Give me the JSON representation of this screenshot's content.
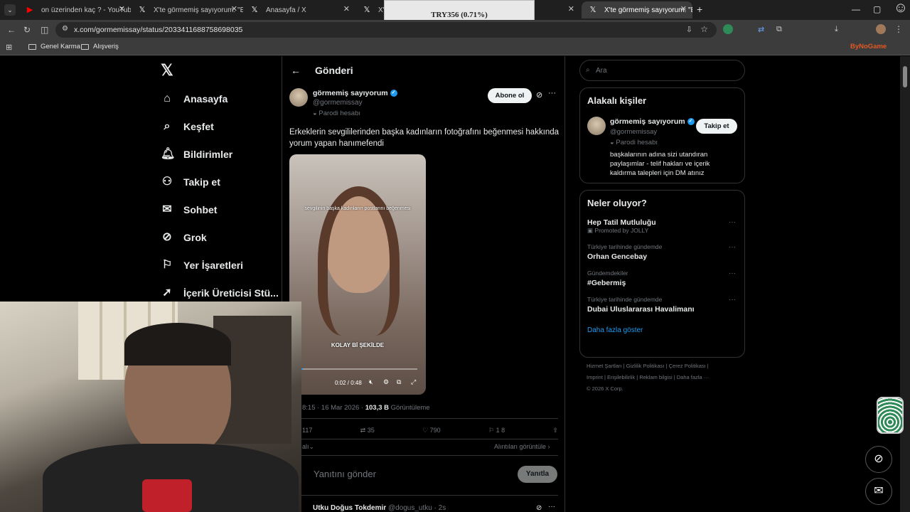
{
  "browser": {
    "tabs": [
      {
        "label": "on üzerinden kaç ? - YouTube",
        "icon": "youtube-icon"
      },
      {
        "label": "X'te görmemiş sayıyorum: \"Erk",
        "icon": "x-logo-icon"
      },
      {
        "label": "Anasayfa / X",
        "icon": "x-logo-icon"
      },
      {
        "label": "X'te G",
        "icon": "x-logo-icon"
      },
      {
        "label": "X'te görmemiş sayıyorum: \"Erk",
        "icon": "x-logo-icon"
      }
    ],
    "overlay_ticker": "TRY356 (0.71%)",
    "url": "x.com/gormemissay/status/2033411688758698035",
    "bookmarks": [
      "Genel Karma",
      "Alışveriş"
    ],
    "bynogame": "ByNoGame"
  },
  "left_nav": {
    "items": [
      {
        "label": "Anasayfa",
        "icon": "home-icon"
      },
      {
        "label": "Keşfet",
        "icon": "search-icon"
      },
      {
        "label": "Bildirimler",
        "icon": "bell-icon"
      },
      {
        "label": "Takip et",
        "icon": "add-user-icon"
      },
      {
        "label": "Sohbet",
        "icon": "mail-icon"
      },
      {
        "label": "Grok",
        "icon": "grok-icon"
      },
      {
        "label": "Yer İşaretleri",
        "icon": "bookmark-icon"
      },
      {
        "label": "İçerik Üreticisi Stü...",
        "icon": "rocket-icon"
      }
    ]
  },
  "post": {
    "header": "Gönderi",
    "author_name": "görmemiş sayıyorum",
    "author_handle": "@gormemissay",
    "parody_label": "Parodi hesabı",
    "follow_label": "Abone ol",
    "text": "Erkeklerin sevgililerinden başka kadınların fotoğrafını beğenmesi hakkında yorum yapan hanımefendi",
    "video": {
      "caption_top": "sevgilinin başka kadınların postlarını beğenmesi",
      "caption_bottom": "KOLAY Bİ ŞEKİLDE",
      "time": "0:02 / 0:48",
      "progress": 0.04
    },
    "timestamp": "8:15 · 16 Mar 2026 · ",
    "views_count": "103,3 B",
    "views_label": "Görüntüleme",
    "replies": "117",
    "reposts": "35",
    "likes": "790",
    "bookmarks": "1 8",
    "relevance_left": "alı",
    "quotes_link": "Alıntıları görüntüle",
    "reply_placeholder": "Yanıtını gönder",
    "reply_button": "Yanıtla",
    "next_reply_name": "Utku Doğus Tokdemir",
    "next_reply_handle": "@dogus_utku · 2s"
  },
  "right_col": {
    "search_placeholder": "Ara",
    "related_title": "Alakalı kişiler",
    "related_name": "görmemiş sayıyorum",
    "related_handle": "@gormemissay",
    "related_parody": "Parodi hesabı",
    "related_follow": "Takip et",
    "related_bio": "başkalarının adına sizi utandıran paylaşımlar - telif hakları ve içerik kaldırma talepleri için DM atınız",
    "trends_title": "Neler oluyor?",
    "trends": [
      {
        "meta": "",
        "title": "Hep Tatil Mutluluğu",
        "sub": "Promoted by JOLLY"
      },
      {
        "meta": "Türkiye tarihinde gündemde",
        "title": "Orhan Gencebay",
        "sub": ""
      },
      {
        "meta": "Gündemdekiler",
        "title": "#Gebermiş",
        "sub": ""
      },
      {
        "meta": "Türkiye tarihinde gündemde",
        "title": "Dubai Uluslararası Havalimanı",
        "sub": ""
      }
    ],
    "show_more": "Daha fazla göster",
    "footer_links": [
      "Hizmet Şartları",
      "Gizlilik Politikası",
      "Çerez Politikası",
      "Imprint",
      "Erişilebilirlik",
      "Reklam bilgisi",
      "Daha fazla ···"
    ],
    "copyright": "© 2026 X Corp."
  },
  "colors": {
    "accent": "#1d9bf0",
    "bg": "#000000",
    "border": "#2f3336",
    "muted": "#71767b"
  }
}
